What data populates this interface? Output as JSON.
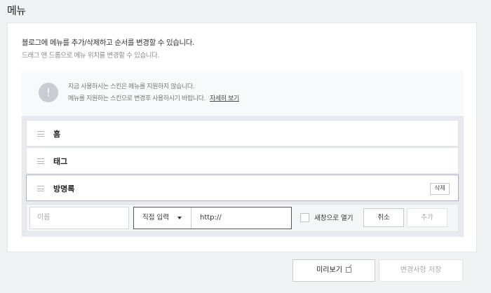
{
  "page": {
    "title": "메뉴"
  },
  "description": {
    "main": "블로그에 메뉴를 추가/삭제하고 순서를 변경할 수 있습니다.",
    "sub": "드래그 앤 드롭으로 메뉴 위치를 변경할 수 있습니다."
  },
  "notice": {
    "icon": "!",
    "line1": "지금 사용하시는 스킨은 메뉴를 지원하지 않습니다.",
    "line2": "메뉴를 지원하는 스킨으로 변경후 사용하시기 바랍니다.",
    "link": "자세히 보기"
  },
  "menu": {
    "items": [
      {
        "label": "홈"
      },
      {
        "label": "태그"
      },
      {
        "label": "방명록",
        "delete_label": "삭제"
      }
    ]
  },
  "add_form": {
    "name_placeholder": "이름",
    "type_selected": "직접 입력",
    "url_value": "http://",
    "new_window_label": "새창으로 열기",
    "cancel_label": "취소",
    "add_label": "추가"
  },
  "footer": {
    "preview_label": "미리보기",
    "save_label": "변경사항 저장"
  }
}
